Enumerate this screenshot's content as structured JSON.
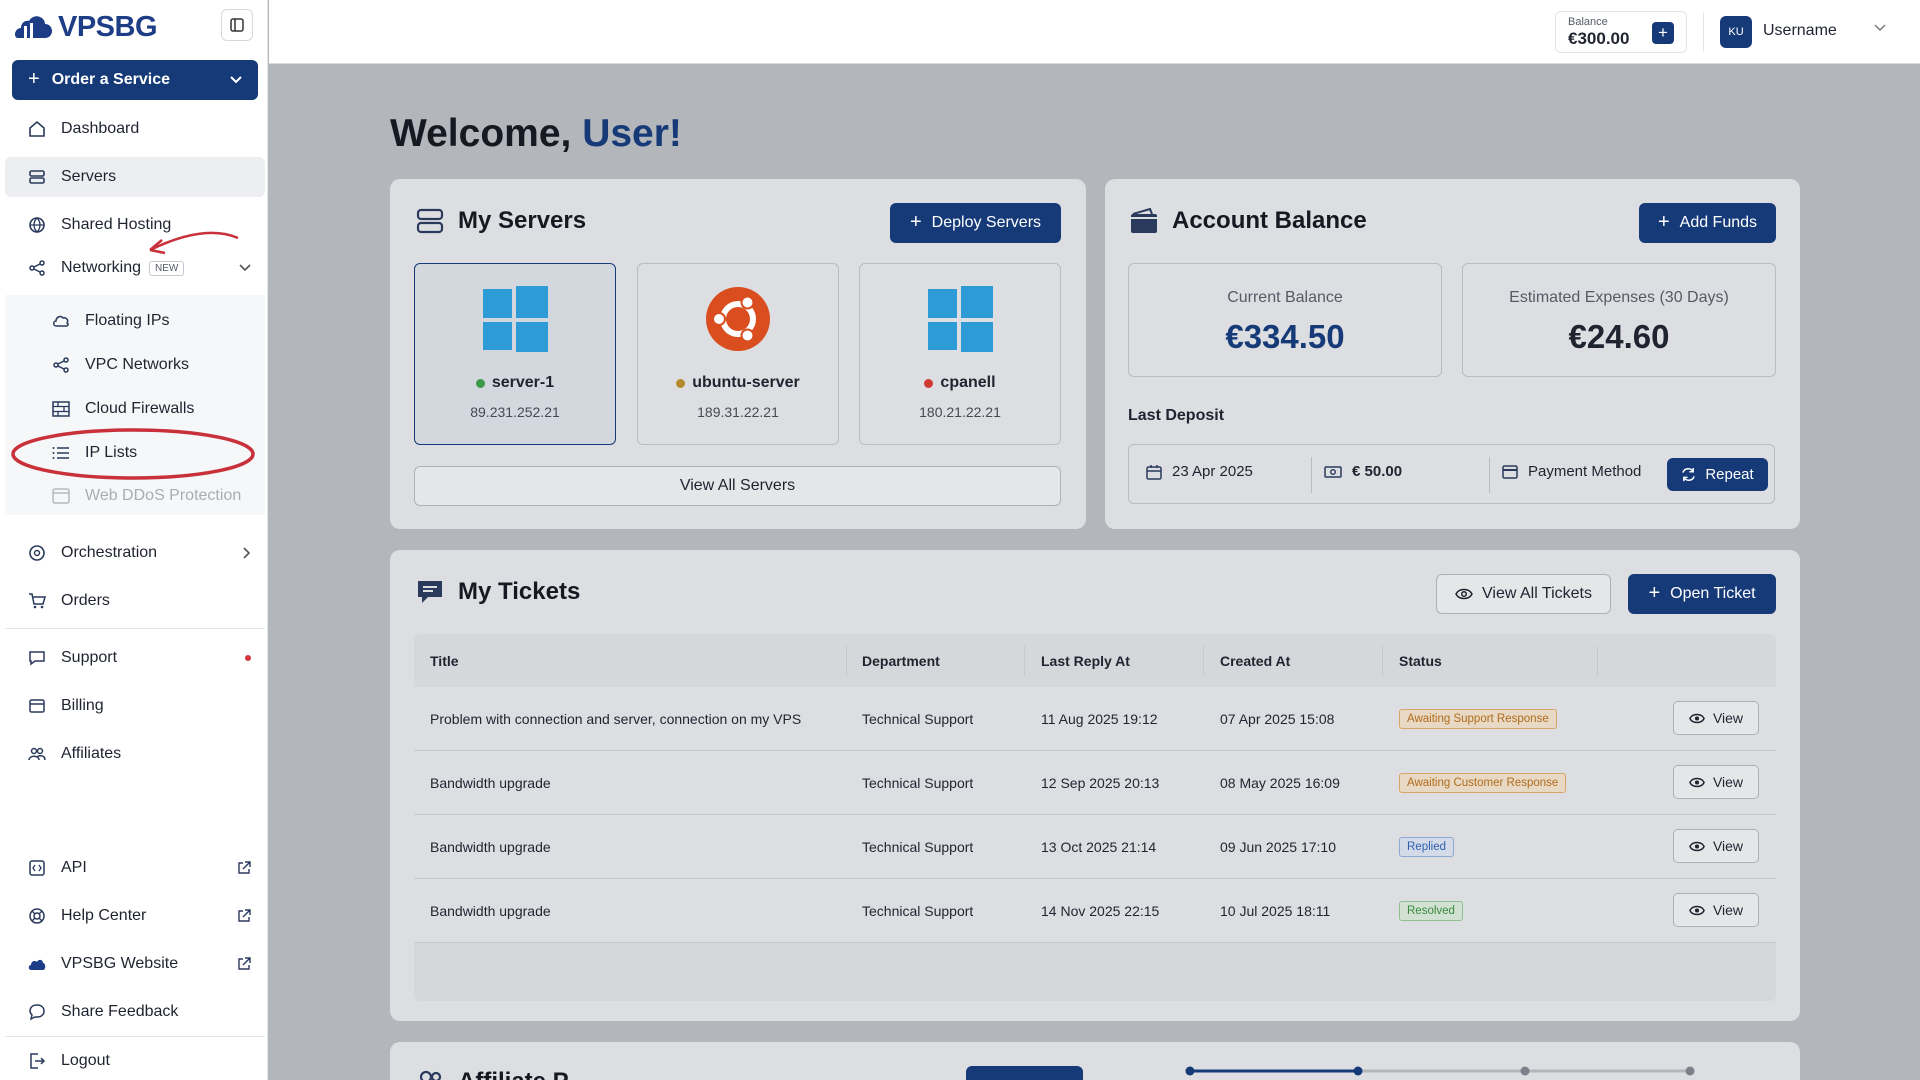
{
  "brand": {
    "name": "VPSBG"
  },
  "sidebar": {
    "order_button": "Order a Service",
    "items": [
      {
        "key": "dashboard",
        "label": "Dashboard"
      },
      {
        "key": "servers",
        "label": "Servers"
      },
      {
        "key": "shared-hosting",
        "label": "Shared Hosting"
      },
      {
        "key": "networking",
        "label": "Networking",
        "badge": "NEW"
      }
    ],
    "networking_sub": [
      {
        "label": "Floating IPs"
      },
      {
        "label": "VPC Networks"
      },
      {
        "label": "Cloud Firewalls"
      },
      {
        "label": "IP Lists"
      },
      {
        "label": "Web DDoS Protection"
      }
    ],
    "items2": [
      {
        "label": "Orchestration"
      },
      {
        "label": "Orders"
      },
      {
        "label": "Support"
      },
      {
        "label": "Billing"
      },
      {
        "label": "Affiliates"
      }
    ],
    "bottom": [
      {
        "label": "API"
      },
      {
        "label": "Help Center"
      },
      {
        "label": "VPSBG Website"
      },
      {
        "label": "Share Feedback"
      },
      {
        "label": "Logout"
      }
    ]
  },
  "topbar": {
    "balance_label": "Balance",
    "balance_value": "€300.00",
    "avatar_initials": "KU",
    "username": "Username"
  },
  "welcome": {
    "prefix": "Welcome, ",
    "name": "User!"
  },
  "servers_panel": {
    "title": "My Servers",
    "deploy_button": "Deploy Servers",
    "view_all": "View All Servers",
    "servers": [
      {
        "name": "server-1",
        "ip": "89.231.252.21",
        "os": "windows",
        "status_color": "#3a9a4a"
      },
      {
        "name": "ubuntu-server",
        "ip": "189.31.22.21",
        "os": "ubuntu",
        "status_color": "#b48a2c"
      },
      {
        "name": "cpanell",
        "ip": "180.21.22.21",
        "os": "windows",
        "status_color": "#d03a32"
      }
    ]
  },
  "balance_panel": {
    "title": "Account Balance",
    "add_funds": "Add Funds",
    "current_label": "Current Balance",
    "current_value": "€334.50",
    "current_color": "#163a78",
    "estimated_label": "Estimated Expenses (30 Days)",
    "estimated_value": "€24.60",
    "last_deposit_label": "Last Deposit",
    "deposit_date": "23 Apr 2025",
    "deposit_amount": "€ 50.00",
    "payment_method": "Payment Method",
    "repeat": "Repeat"
  },
  "tickets_panel": {
    "title": "My Tickets",
    "view_all": "View All Tickets",
    "open_ticket": "Open Ticket",
    "columns": [
      "Title",
      "Department",
      "Last Reply At",
      "Created At",
      "Status"
    ],
    "rows": [
      {
        "title": "Problem with connection and server, connection on my VPS",
        "department": "Technical Support",
        "last_reply": "11 Aug 2025 19:12",
        "created": "07 Apr 2025 15:08",
        "status": "Awaiting Support Response",
        "status_color": "#b26b1c",
        "view": "View"
      },
      {
        "title": "Bandwidth upgrade",
        "department": "Technical Support",
        "last_reply": "12 Sep 2025 20:13",
        "created": "08 May 2025 16:09",
        "status": "Awaiting Customer Response",
        "status_color": "#b26b1c",
        "view": "View"
      },
      {
        "title": "Bandwidth upgrade",
        "department": "Technical Support",
        "last_reply": "13 Oct 2025 21:14",
        "created": "09 Jun 2025 17:10",
        "status": "Replied",
        "status_color": "#2f5fb0",
        "view": "View"
      },
      {
        "title": "Bandwidth upgrade",
        "department": "Technical Support",
        "last_reply": "14 Nov 2025 22:15",
        "created": "10 Jul 2025 18:11",
        "status": "Resolved",
        "status_color": "#3a8a3e",
        "view": "View"
      }
    ]
  },
  "affiliate_panel": {
    "title": "Affiliate P"
  }
}
